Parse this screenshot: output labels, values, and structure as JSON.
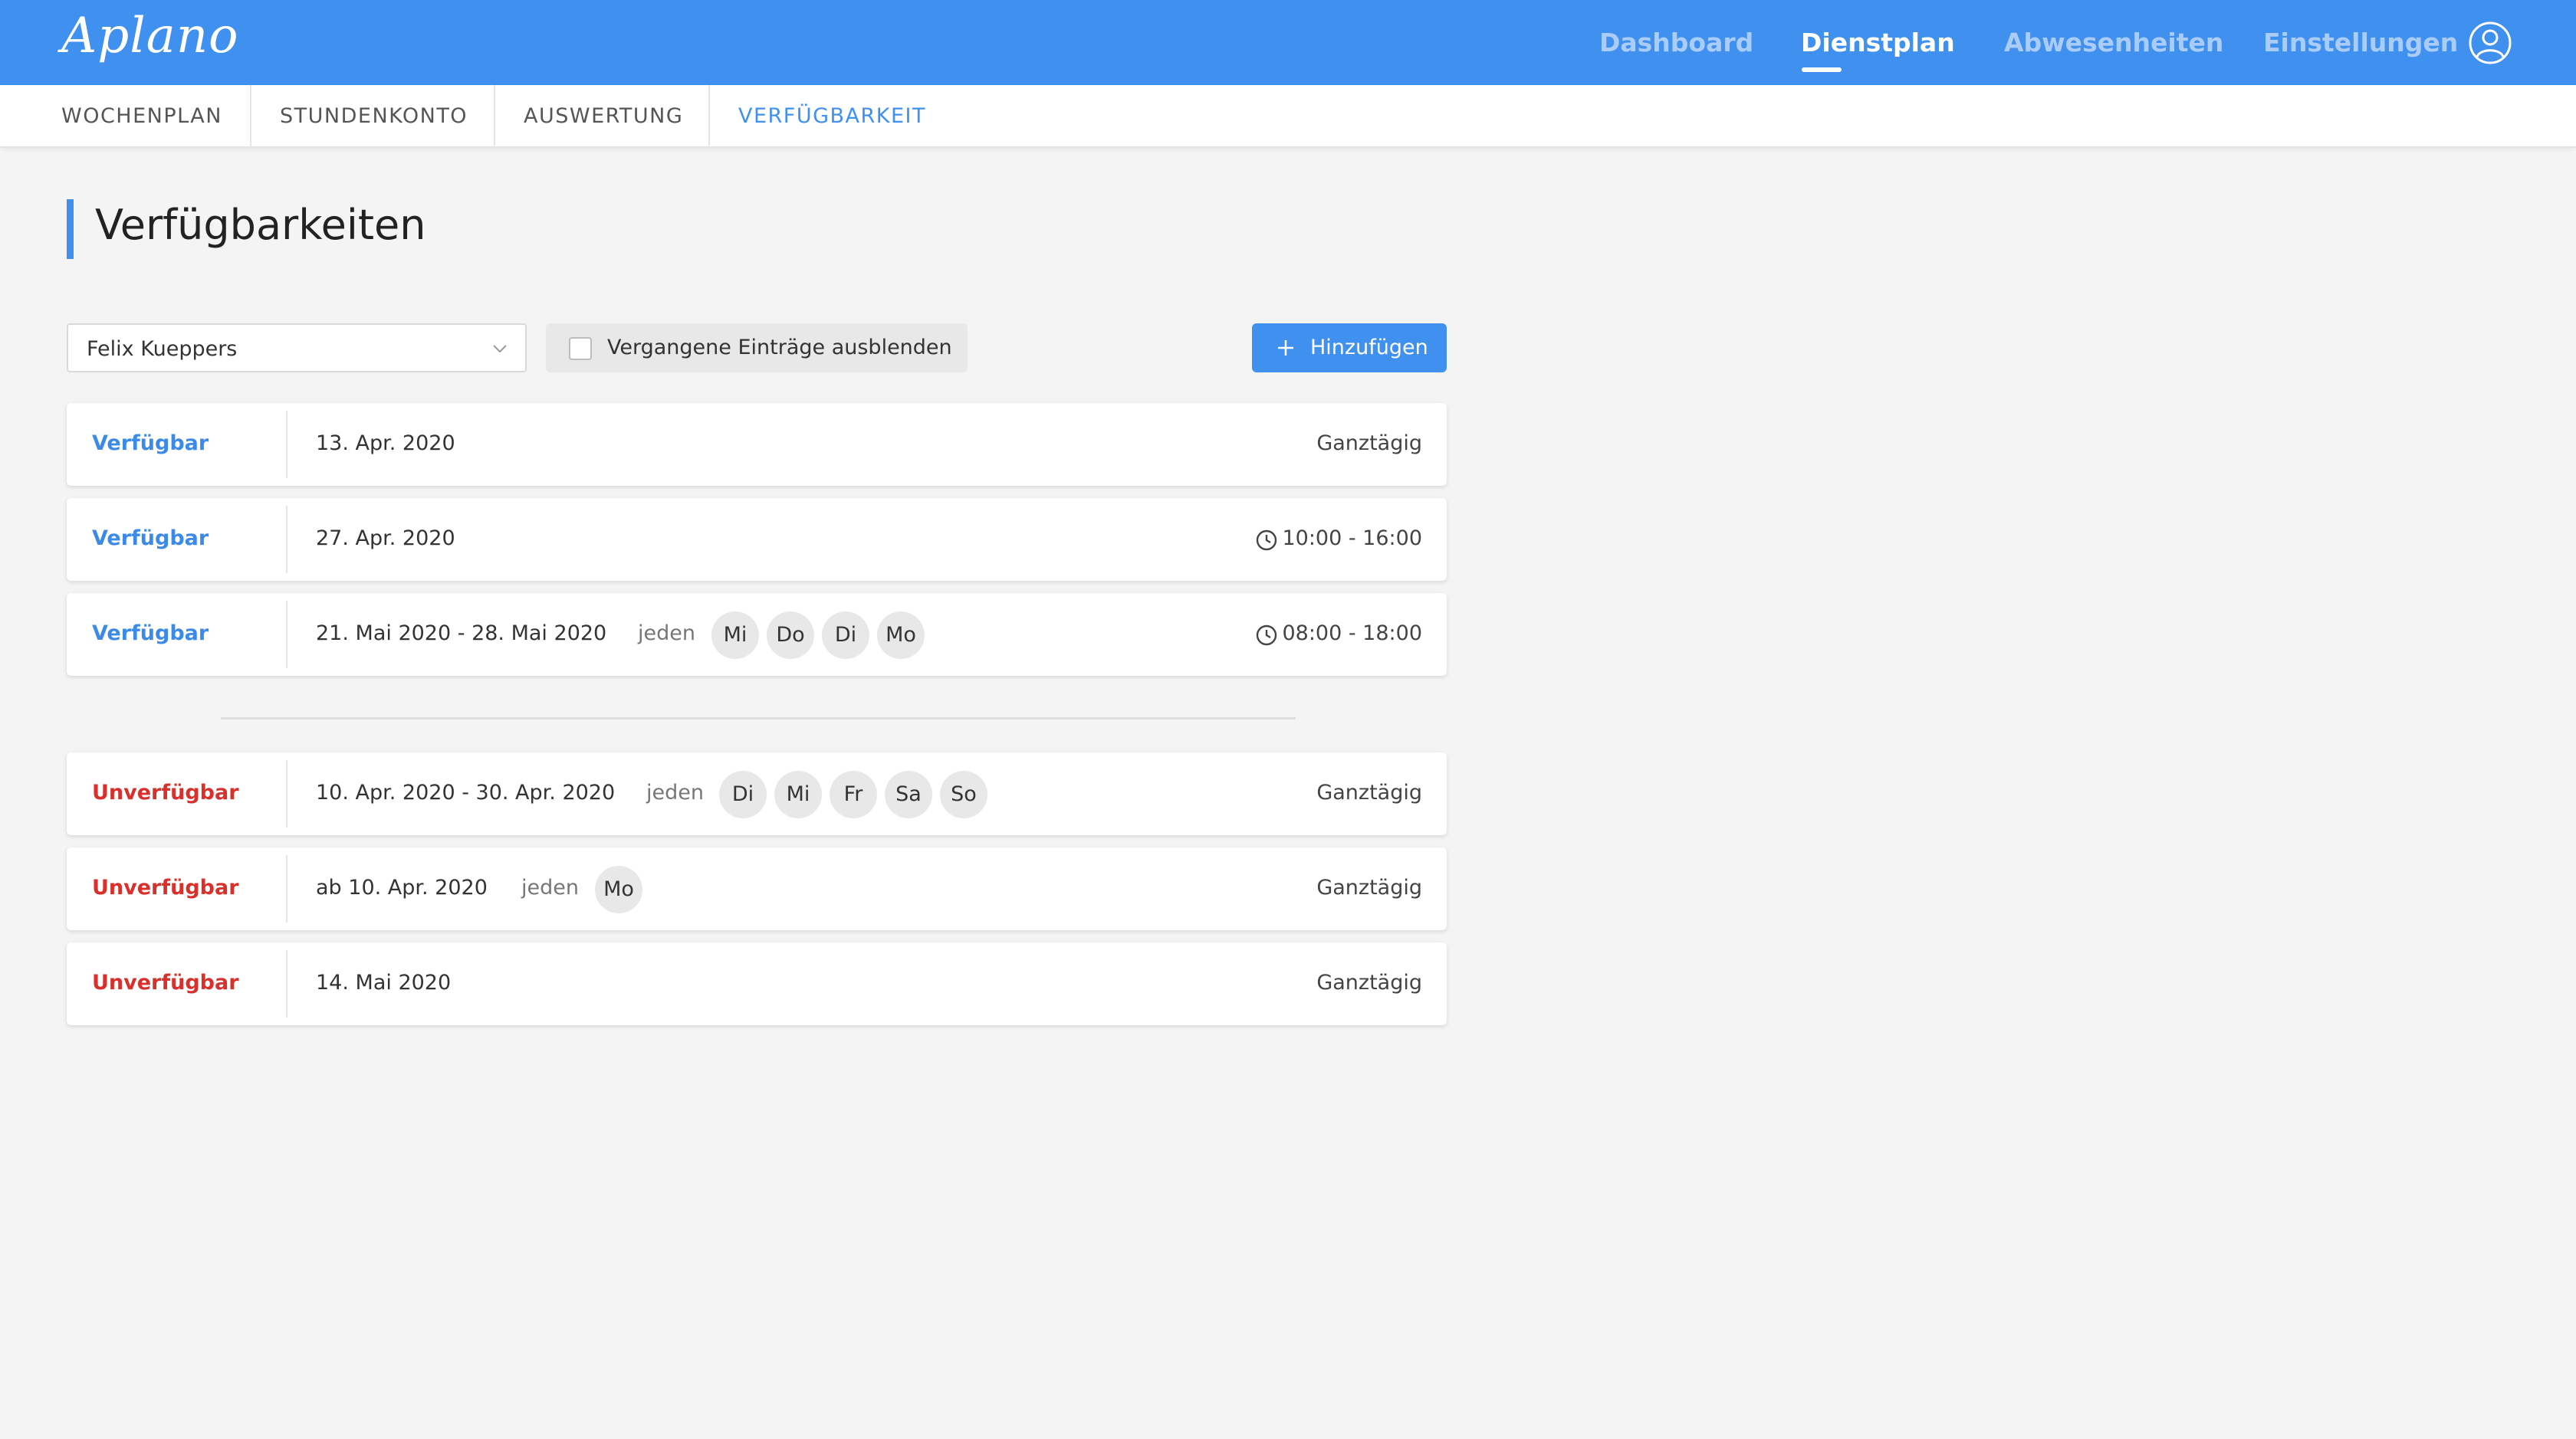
{
  "app": {
    "logo": "Aplano"
  },
  "main_nav": {
    "items": [
      "Dashboard",
      "Dienstplan",
      "Abwesenheiten",
      "Einstellungen"
    ],
    "active": "Dienstplan"
  },
  "sub_nav": {
    "tabs": [
      "WOCHENPLAN",
      "STUNDENKONTO",
      "AUSWERTUNG",
      "VERFÜGBARKEIT"
    ],
    "active": "VERFÜGBARKEIT"
  },
  "page": {
    "title": "Verfügbarkeiten"
  },
  "controls": {
    "user_select": "Felix Kueppers",
    "hide_past_label": "Vergangene Einträge ausblenden",
    "hide_past_checked": false,
    "add_label": "Hinzufügen"
  },
  "available": [
    {
      "status": "Verfügbar",
      "date": "13. Apr. 2020",
      "jeden": "",
      "days": [],
      "time": "Ganztägig",
      "clock": false
    },
    {
      "status": "Verfügbar",
      "date": "27. Apr. 2020",
      "jeden": "",
      "days": [],
      "time": "10:00  -  16:00",
      "clock": true
    },
    {
      "status": "Verfügbar",
      "date": "21. Mai 2020  -  28. Mai 2020",
      "jeden": "jeden",
      "days": [
        "Mi",
        "Do",
        "Di",
        "Mo"
      ],
      "time": "08:00  -  18:00",
      "clock": true
    }
  ],
  "unavailable": [
    {
      "status": "Unverfügbar",
      "date": "10. Apr. 2020  -  30. Apr. 2020",
      "jeden": "jeden",
      "days": [
        "Di",
        "Mi",
        "Fr",
        "Sa",
        "So"
      ],
      "time": "Ganztägig",
      "clock": false
    },
    {
      "status": "Unverfügbar",
      "date": "ab  10. Apr. 2020",
      "jeden": "jeden",
      "days": [
        "Mo"
      ],
      "time": "Ganztägig",
      "clock": false
    },
    {
      "status": "Unverfügbar",
      "date": "14. Mai 2020",
      "jeden": "",
      "days": [],
      "time": "Ganztägig",
      "clock": false
    }
  ],
  "colors": {
    "brand": "#4090f0",
    "available": "#3c8ae8",
    "unavailable": "#d9302c"
  }
}
